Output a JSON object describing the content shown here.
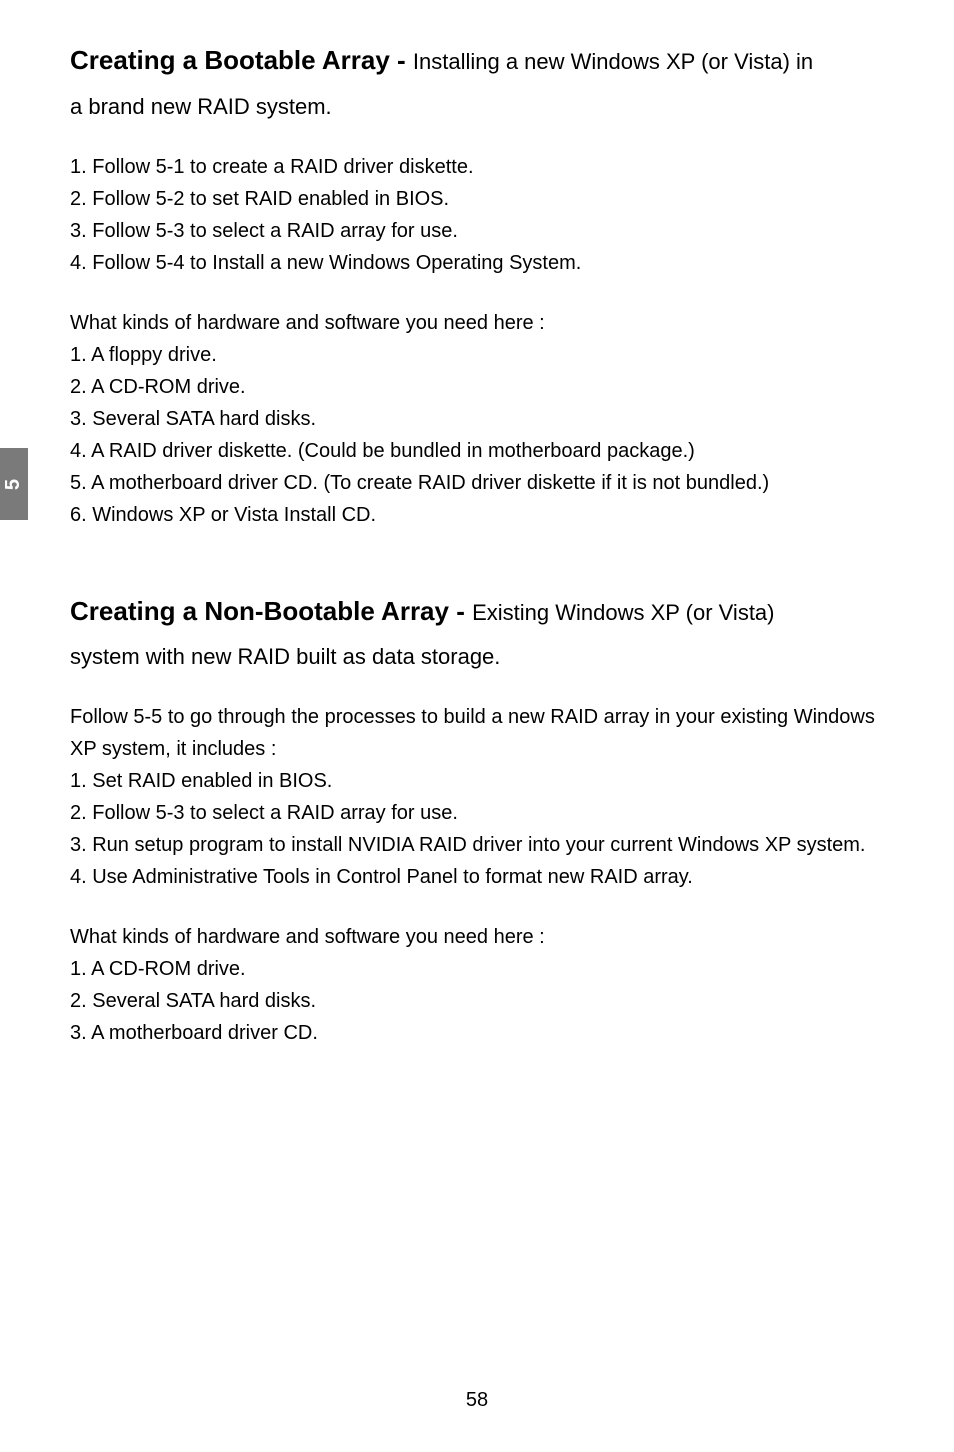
{
  "sideTab": "5",
  "pageNumber": "58",
  "section1": {
    "headingBold": "Creating a Bootable Array - ",
    "headingRegular": "Installing a new Windows XP (or Vista) in",
    "headingLine2": "a brand new RAID system.",
    "steps": [
      "1. Follow 5-1 to create a RAID driver diskette.",
      "2. Follow 5-2 to set RAID enabled in BIOS.",
      "3. Follow 5-3 to select a RAID array for use.",
      "4. Follow 5-4 to Install a new Windows Operating System."
    ],
    "needsHeading": "What kinds of hardware and software you need here :",
    "needs": [
      "1. A floppy drive.",
      "2. A CD-ROM drive.",
      "3. Several SATA hard disks.",
      "4. A RAID driver diskette. (Could be bundled in motherboard package.)",
      "5. A motherboard driver CD. (To create RAID driver diskette if it is not bundled.)",
      "6. Windows XP or Vista Install CD."
    ]
  },
  "section2": {
    "headingBold": "Creating a Non-Bootable Array - ",
    "headingRegular": "Existing Windows XP (or Vista)",
    "headingLine2": "system with new RAID built as data storage.",
    "intro": "Follow 5-5 to go through the processes to build a new RAID array in your existing Windows XP system, it includes :",
    "steps": [
      "1. Set RAID enabled in BIOS.",
      "2. Follow 5-3 to select a RAID array for use.",
      "3. Run setup program to install NVIDIA RAID driver into your current Windows XP system.",
      "4. Use Administrative Tools in Control Panel to format new RAID array."
    ],
    "needsHeading": "What kinds of hardware and software you need here :",
    "needs": [
      "1. A CD-ROM drive.",
      "2. Several SATA hard disks.",
      "3. A motherboard driver CD."
    ]
  }
}
